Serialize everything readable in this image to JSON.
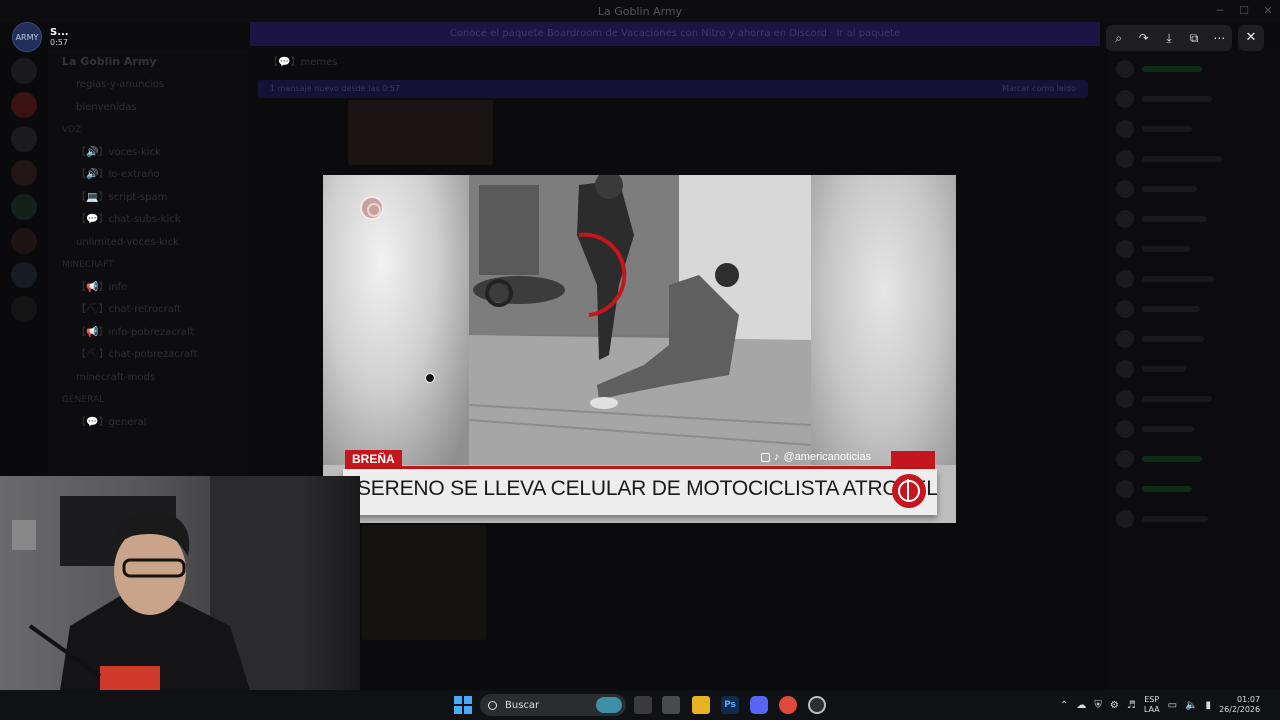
{
  "window": {
    "title": "La Goblin Army"
  },
  "banner": {
    "text": "Conocé el paquete Boardroom de Vacaciones con Nitro y ahorra en Discord · Ir al paquete"
  },
  "server": {
    "name": "La Goblin Army",
    "channels": [
      {
        "label": "reglas-y-anuncios",
        "kind": "chan"
      },
      {
        "label": "bienvenidas",
        "kind": "chan"
      },
      {
        "label": "VOZ",
        "kind": "cat"
      },
      {
        "label": "【🔊】voces-kick",
        "kind": "chan"
      },
      {
        "label": "【🔊】lo-extraño",
        "kind": "chan"
      },
      {
        "label": "【💻】script-spam",
        "kind": "chan"
      },
      {
        "label": "【💬】chat-subs-kick",
        "kind": "chan"
      },
      {
        "label": "unlimited-voces-kick",
        "kind": "chan"
      },
      {
        "label": "MINECRAFT",
        "kind": "cat"
      },
      {
        "label": "【📢】info",
        "kind": "chan"
      },
      {
        "label": "【⛏】chat-retrocraft",
        "kind": "chan"
      },
      {
        "label": "【📢】info-pobrezacraft",
        "kind": "chan"
      },
      {
        "label": "【⛏】chat-pobrezacraft",
        "kind": "chan"
      },
      {
        "label": "minecraft-mods",
        "kind": "chan"
      },
      {
        "label": "GENERAL",
        "kind": "cat"
      },
      {
        "label": "【💬】general",
        "kind": "chan"
      }
    ]
  },
  "chat": {
    "channel": "【💬】memes",
    "new_messages": "1 mensaje nuevo desde las 0:57",
    "mark_read": "Marcar como leído"
  },
  "stream": {
    "streamer": "S...",
    "elapsed": "0:57",
    "avatar_text": "ARMY"
  },
  "viewer_tools": [
    {
      "name": "zoom-icon",
      "glyph": "⌕"
    },
    {
      "name": "forward-icon",
      "glyph": "↷"
    },
    {
      "name": "download-icon",
      "glyph": "⤓"
    },
    {
      "name": "open-external-icon",
      "glyph": "⧉"
    },
    {
      "name": "more-icon",
      "glyph": "⋯"
    }
  ],
  "close_glyph": "✕",
  "news": {
    "location": "BREÑA",
    "social_handle": "@americanoticias",
    "headline": "SERENO SE LLEVA CELULAR DE MOTOCICLISTA ATROPELLADO",
    "accent": "#c5161d"
  },
  "taskbar": {
    "search_placeholder": "Buscar",
    "lang_top": "ESP",
    "lang_bottom": "LAA",
    "time": "01:07",
    "date": "26/2/2026"
  }
}
